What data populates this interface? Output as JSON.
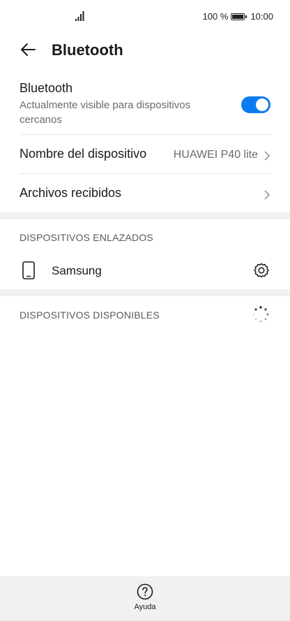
{
  "status_bar": {
    "battery": "100 %",
    "time": "10:00"
  },
  "header": {
    "title": "Bluetooth"
  },
  "bluetooth": {
    "title": "Bluetooth",
    "subtitle": "Actualmente visible para dispositivos cercanos",
    "enabled": true
  },
  "device_name": {
    "label": "Nombre del dispositivo",
    "value": "HUAWEI P40 lite"
  },
  "received_files": {
    "label": "Archivos recibidos"
  },
  "paired": {
    "section_label": "DISPOSITIVOS ENLAZADOS",
    "devices": [
      {
        "name": "Samsung"
      }
    ]
  },
  "available": {
    "section_label": "DISPOSITIVOS DISPONIBLES"
  },
  "bottom_bar": {
    "help_label": "Ayuda"
  },
  "colors": {
    "accent": "#0a7cf0",
    "background": "#ffffff",
    "band": "#f1f1f1"
  },
  "icons": [
    "signal-icon",
    "battery-icon",
    "back-arrow-icon",
    "chevron-right-icon",
    "phone-icon",
    "gear-icon",
    "loading-spinner-icon",
    "help-icon"
  ]
}
